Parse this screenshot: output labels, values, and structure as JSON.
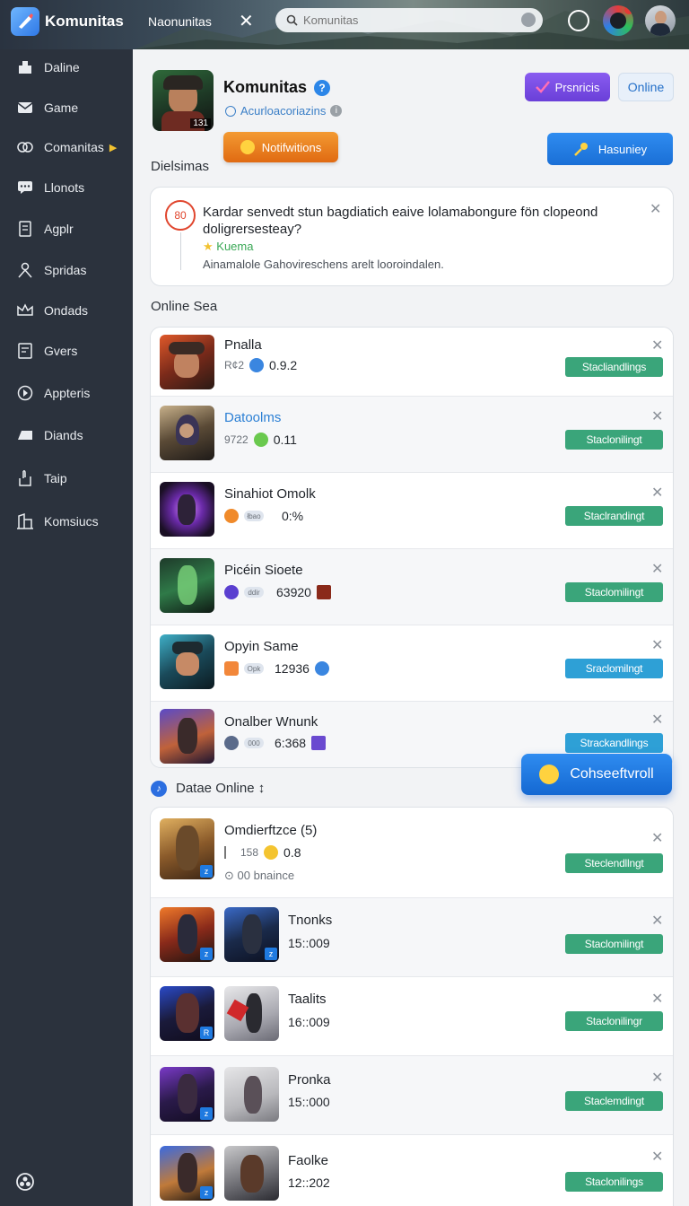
{
  "topbar": {
    "app_name": "Komunitas",
    "tab_label": "Naonunitas",
    "search_placeholder": "Komunitas"
  },
  "sidebar": {
    "items": [
      {
        "label": "Daline",
        "icon": "home-icon"
      },
      {
        "label": "Game",
        "icon": "mail-icon"
      },
      {
        "label": "Comanitas",
        "icon": "community-icon",
        "active": true
      },
      {
        "label": "Llonots",
        "icon": "chat-icon"
      },
      {
        "label": "Agplr",
        "icon": "document-icon"
      },
      {
        "label": "Spridas",
        "icon": "person-icon"
      },
      {
        "label": "Ondads",
        "icon": "crown-icon"
      },
      {
        "label": "Gvers",
        "icon": "list-icon"
      },
      {
        "label": "Appteris",
        "icon": "target-icon"
      },
      {
        "label": "Diands",
        "icon": "monitor-icon"
      },
      {
        "label": "Taip",
        "icon": "hand-icon"
      },
      {
        "label": "Komsiucs",
        "icon": "building-icon"
      }
    ]
  },
  "header": {
    "title": "Komunitas",
    "verified_mark": "?",
    "subtitle": "Acurloacoriazins",
    "avatar_badge": "131",
    "notif_button": "Notifwitions",
    "premium_button": "Prsnricis",
    "online_button": "Online",
    "hash_button": "Hasuniey",
    "section_label": "Dielsimas"
  },
  "notice": {
    "ring_text": "80",
    "message": "Kardar senvedt stun bagdiatich eaive lolamabongure fön clopeond doligrersesteay?",
    "tag": "Kuema",
    "description": "Ainamalole Gahovireschens arelt looroindalen."
  },
  "online_section": {
    "label": "Online Sea",
    "rows": [
      {
        "name": "Pnalla",
        "small": "R¢2",
        "value": "0.9.2",
        "action": "Stacliandlings",
        "link": false
      },
      {
        "name": "Datoolms",
        "small": "9722",
        "value": "0.11",
        "action": "Staclonilingt",
        "link": true
      },
      {
        "name": "Sinahiot Omolk",
        "small": "łbao",
        "value": "0:%",
        "action": "Staclrandingt",
        "link": false
      },
      {
        "name": "Picéin Sioete",
        "small": "ddir",
        "value": "63920",
        "action": "Staclomilingt",
        "link": false
      },
      {
        "name": "Opyin Same",
        "small": "Opk",
        "value": "12936",
        "action": "Sraclomilngt",
        "link": false
      },
      {
        "name": "Onalber Wnunk",
        "small": "000",
        "value": "6:368",
        "action": "Strackandlings",
        "link": false
      }
    ]
  },
  "float_button": "Cohseeftvroll",
  "data_section": {
    "label": "Datae Online ↕",
    "rows": [
      {
        "name": "Omdierftzce (5)",
        "small": "158",
        "value": "0.8",
        "sub": "00 bnaince",
        "action": "Steclendllngt"
      },
      {
        "name": "Tnonks",
        "value": "15::009",
        "action": "Staclomilingt"
      },
      {
        "name": "Taalits",
        "value": "16::009",
        "action": "Staclonilingr"
      },
      {
        "name": "Pronka",
        "value": "15::000",
        "action": "Staclemdingt"
      },
      {
        "name": "Faolke",
        "value": "12::202",
        "action": "Staclonilings"
      }
    ]
  }
}
